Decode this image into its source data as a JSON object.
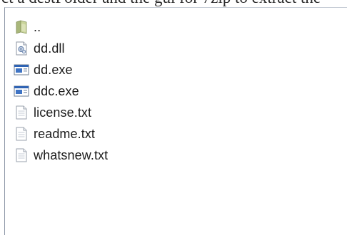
{
  "caption_fragment": "ct a destFolder and the gui for 7zip to extract the",
  "file_list": {
    "items": [
      {
        "label": "..",
        "icon": "folder-up-icon"
      },
      {
        "label": "dd.dll",
        "icon": "dll-file-icon"
      },
      {
        "label": "dd.exe",
        "icon": "exe-file-icon"
      },
      {
        "label": "ddc.exe",
        "icon": "exe-file-icon"
      },
      {
        "label": "license.txt",
        "icon": "text-file-icon"
      },
      {
        "label": "readme.txt",
        "icon": "text-file-icon"
      },
      {
        "label": "whatsnew.txt",
        "icon": "text-file-icon"
      }
    ]
  },
  "colors": {
    "folder": "#b7c28a",
    "exe_blue": "#2f63b3",
    "border": "#8c96a6"
  }
}
